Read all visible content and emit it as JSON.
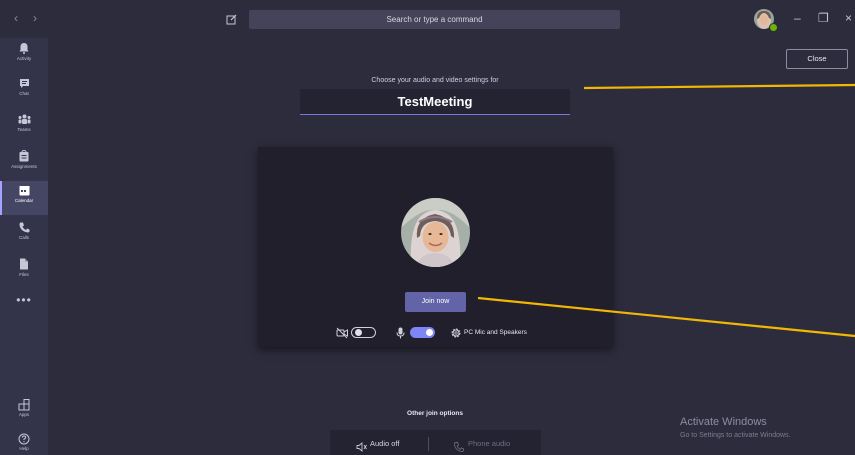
{
  "titlebar": {
    "back_glyph": "‹",
    "forward_glyph": "›",
    "search_placeholder": "Search or type a command",
    "minimize_glyph": "–",
    "maximize_glyph": "❐",
    "close_glyph": "×"
  },
  "rail": {
    "items": [
      {
        "label": "Activity",
        "icon": "bell-icon"
      },
      {
        "label": "Chat",
        "icon": "chat-icon"
      },
      {
        "label": "Teams",
        "icon": "teams-icon"
      },
      {
        "label": "Assignments",
        "icon": "assignments-icon"
      },
      {
        "label": "Calendar",
        "icon": "calendar-icon",
        "active": true
      },
      {
        "label": "Calls",
        "icon": "phone-icon"
      },
      {
        "label": "Files",
        "icon": "file-icon"
      }
    ],
    "more_glyph": "•••",
    "apps_label": "Apps",
    "help_label": "Help"
  },
  "main": {
    "close_label": "Close",
    "choose_text": "Choose your audio and video settings for",
    "meeting_name": "TestMeeting",
    "join_label": "Join now",
    "camera_on": false,
    "mic_on": true,
    "audio_device_label": "PC Mic and Speakers",
    "other_options_title": "Other join options",
    "audio_off_label": "Audio off",
    "phone_audio_label": "Phone audio"
  },
  "watermark": {
    "title": "Activate Windows",
    "subtitle": "Go to Settings to activate Windows."
  },
  "colors": {
    "background": "#2d2c3c",
    "rail": "#33344a",
    "accent": "#6264a7",
    "toggle_on": "#7f85f5",
    "annotation_line": "#f2b705"
  }
}
